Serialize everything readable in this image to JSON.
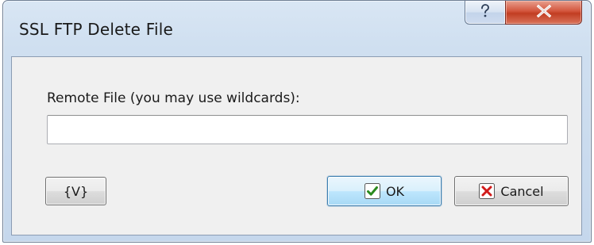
{
  "window": {
    "title": "SSL FTP Delete File",
    "help_icon": "question-mark-icon",
    "close_icon": "close-icon"
  },
  "form": {
    "remote_file_label": "Remote File (you may use wildcards):",
    "remote_file_value": "",
    "remote_file_placeholder": ""
  },
  "buttons": {
    "variables_label": "{V}",
    "ok_label": "OK",
    "ok_icon": "check-icon",
    "cancel_label": "Cancel",
    "cancel_icon": "x-icon"
  },
  "colors": {
    "close_button": "#c13d22",
    "ok_check": "#2a8a1e",
    "cancel_x": "#d11b1b",
    "default_button_border": "#3c7fb1"
  }
}
